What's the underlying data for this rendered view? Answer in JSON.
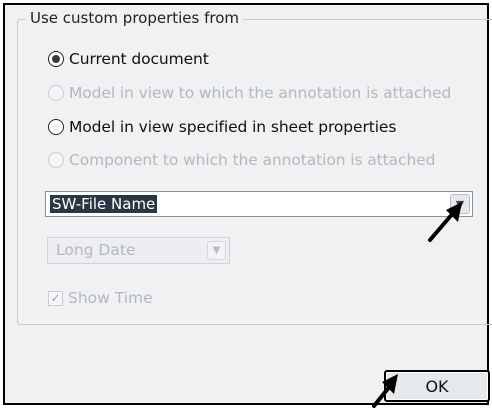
{
  "group": {
    "title": "Use custom properties from"
  },
  "radios": [
    {
      "label": "Current document",
      "checked": true,
      "enabled": true
    },
    {
      "label": "Model in view to which the annotation is attached",
      "checked": false,
      "enabled": false
    },
    {
      "label": "Model in view specified in sheet properties",
      "checked": false,
      "enabled": true
    },
    {
      "label": "Component to which the annotation is attached",
      "checked": false,
      "enabled": false
    }
  ],
  "property_combo": {
    "value": "SW-File Name",
    "icon": "chevron-down-icon"
  },
  "date_combo": {
    "value": "Long Date",
    "enabled": false,
    "icon": "chevron-down-icon"
  },
  "show_time": {
    "label": "Show Time",
    "checked": true,
    "enabled": false
  },
  "buttons": {
    "ok_label": "OK"
  },
  "annotations": {
    "pointer_icon": "pointer-arrow-icon"
  },
  "colors": {
    "dialog_bg": "#eff1f3",
    "selection_bg": "#2a3644",
    "disabled_text": "#b4b8bd"
  }
}
